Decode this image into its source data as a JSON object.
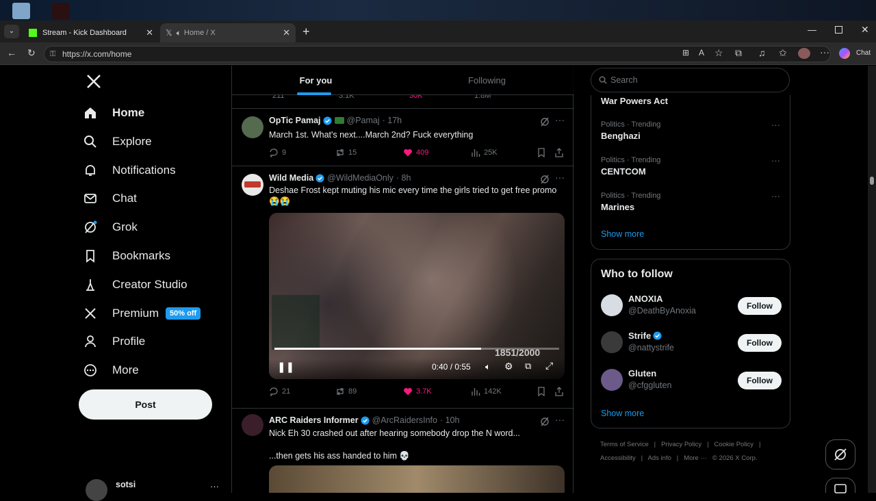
{
  "browser": {
    "tabs": [
      {
        "title": "Stream - Kick Dashboard"
      },
      {
        "title": "Home / X"
      }
    ],
    "url": "https://x.com/home",
    "chat_label": "Chat"
  },
  "nav": {
    "items": [
      {
        "label": "Home",
        "icon": "home-icon"
      },
      {
        "label": "Explore",
        "icon": "search-icon"
      },
      {
        "label": "Notifications",
        "icon": "bell-icon"
      },
      {
        "label": "Chat",
        "icon": "mail-icon"
      },
      {
        "label": "Grok",
        "icon": "grok-icon"
      },
      {
        "label": "Bookmarks",
        "icon": "bookmark-icon"
      },
      {
        "label": "Creator Studio",
        "icon": "creator-icon"
      },
      {
        "label": "Premium",
        "icon": "x-logo-icon",
        "badge": "50% off"
      },
      {
        "label": "Profile",
        "icon": "person-icon"
      },
      {
        "label": "More",
        "icon": "more-circle-icon"
      }
    ],
    "post_label": "Post",
    "account_name": "sotsi"
  },
  "feed": {
    "tabs": [
      "For you",
      "Following"
    ],
    "prev_stats": {
      "replies": "211",
      "reposts": "3.1K",
      "likes": "30K",
      "views": "1.8M"
    },
    "tweets": [
      {
        "name": "OpTic Pamaj",
        "handle": "@Pamaj",
        "time": "· 17h",
        "text": "March 1st. What's next....March 2nd? Fuck everything",
        "replies": "9",
        "reposts": "15",
        "likes": "409",
        "views": "25K"
      },
      {
        "name": "Wild Media",
        "handle": "@WildMediaOnly",
        "time": "· 8h",
        "text": "Deshae Frost kept muting his mic every time the girls tried to get free promo 😭😭",
        "video_time": "0:40 / 0:55",
        "video_counter": "1851/2000",
        "video_progress": 0.727,
        "replies": "21",
        "reposts": "89",
        "likes": "3.7K",
        "views": "142K"
      },
      {
        "name": "ARC Raiders Informer",
        "handle": "@ArcRaidersInfo",
        "time": "· 10h",
        "text": "Nick Eh 30 crashed out after hearing somebody drop the N word...",
        "text2": "...then gets his ass handed to him 💀"
      }
    ]
  },
  "right": {
    "search_placeholder": "Search",
    "trends_top": "War Powers Act",
    "trends": [
      {
        "context": "Politics · Trending",
        "name": "Benghazi"
      },
      {
        "context": "Politics · Trending",
        "name": "CENTCOM"
      },
      {
        "context": "Politics · Trending",
        "name": "Marines"
      }
    ],
    "show_more": "Show more",
    "who_to_follow": "Who to follow",
    "suggestions": [
      {
        "name": "ANOXIA",
        "handle": "@DeathByAnoxia",
        "verified": false
      },
      {
        "name": "Strife",
        "handle": "@nattystrife",
        "verified": true
      },
      {
        "name": "Gluten",
        "handle": "@cfggluten",
        "verified": false
      }
    ],
    "follow_label": "Follow",
    "footer": {
      "line1": [
        "Terms of Service",
        "|",
        "Privacy Policy",
        "|",
        "Cookie Policy",
        "|"
      ],
      "line2": [
        "Accessibility",
        "|",
        "Ads info",
        "|",
        "More ···",
        "© 2026 X Corp."
      ]
    }
  },
  "colors": {
    "accent": "#1d9bf0",
    "like": "#f91880",
    "bg": "#000000",
    "muted": "#71767b"
  }
}
